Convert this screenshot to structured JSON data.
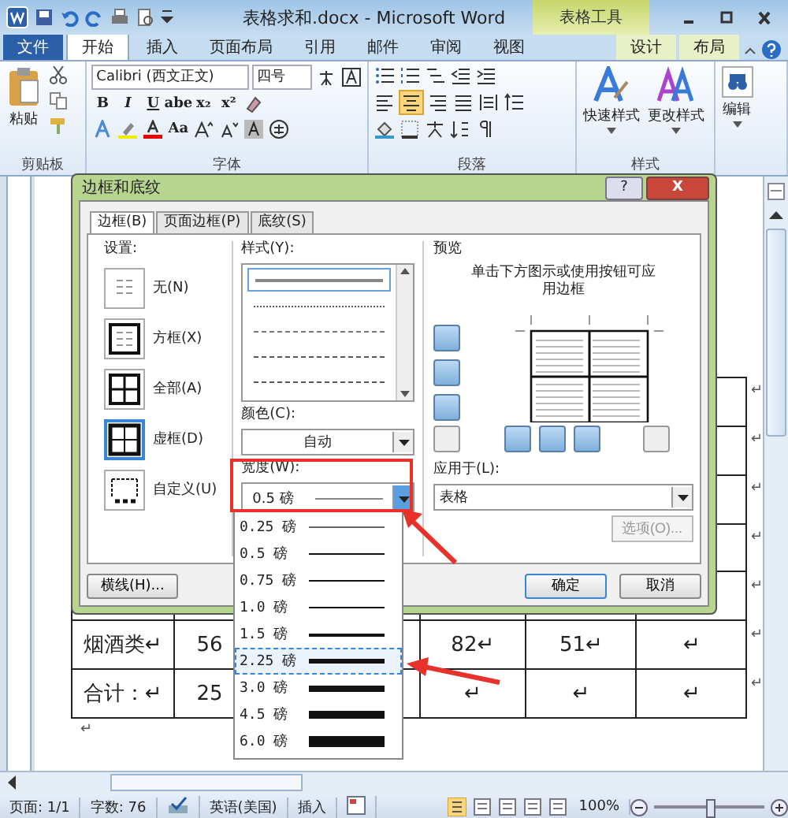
{
  "window": {
    "title": "表格求和.docx  -  Microsoft Word",
    "context_tab": "表格工具"
  },
  "tabs": [
    {
      "label": "文件",
      "kind": "file",
      "selected": false
    },
    {
      "label": "开始",
      "kind": "tab",
      "selected": true
    },
    {
      "label": "插入",
      "kind": "tab",
      "selected": false
    },
    {
      "label": "页面布局",
      "kind": "tab",
      "selected": false
    },
    {
      "label": "引用",
      "kind": "tab",
      "selected": false
    },
    {
      "label": "邮件",
      "kind": "tab",
      "selected": false
    },
    {
      "label": "审阅",
      "kind": "tab",
      "selected": false
    },
    {
      "label": "视图",
      "kind": "tab",
      "selected": false
    },
    {
      "label": "设计",
      "kind": "context",
      "selected": false
    },
    {
      "label": "布局",
      "kind": "context",
      "selected": false
    }
  ],
  "ribbon": {
    "clipboard": {
      "paste": "粘贴",
      "label": "剪贴板"
    },
    "font": {
      "name": "Calibri (西文正文)",
      "size": "四号",
      "format_buttons": [
        "B",
        "I",
        "U",
        "abe",
        "x₂",
        "x²"
      ],
      "case_button": "Aa",
      "label": "字体"
    },
    "paragraph": {
      "label": "段落"
    },
    "styles": {
      "buttons": [
        "快速样式",
        "更改样式"
      ],
      "label": "样式"
    },
    "editing": {
      "button": "编辑"
    }
  },
  "document": {
    "rows": [
      {
        "end": "↵"
      },
      {
        "end": "↵"
      },
      {
        "end": "↵"
      },
      {
        "end": "↵"
      },
      {
        "end": "↵"
      },
      {
        "cells": [
          "烟酒类↵",
          "56",
          "",
          "82↵",
          "51↵",
          "↵"
        ],
        "end": "↵"
      },
      {
        "cells": [
          "合计：↵",
          "25",
          "",
          "↵",
          "↵",
          "↵"
        ],
        "end": "↵"
      }
    ],
    "after_mark": "↵"
  },
  "dialog": {
    "title": "边框和底纹",
    "help": "?",
    "close": "X",
    "tabs": [
      {
        "label": "边框(B)",
        "selected": true
      },
      {
        "label": "页面边框(P)",
        "selected": false
      },
      {
        "label": "底纹(S)",
        "selected": false
      }
    ],
    "setting_label": "设置:",
    "settings": [
      {
        "label": "无(N)",
        "kind": "none",
        "selected": false
      },
      {
        "label": "方框(X)",
        "kind": "box",
        "selected": false
      },
      {
        "label": "全部(A)",
        "kind": "all",
        "selected": false
      },
      {
        "label": "虚框(D)",
        "kind": "grid",
        "selected": true
      },
      {
        "label": "自定义(U)",
        "kind": "custom",
        "selected": false
      }
    ],
    "style_label": "样式(Y):",
    "styles": [
      {
        "kind": "solid",
        "selected": true
      },
      {
        "kind": "dotted",
        "selected": false
      },
      {
        "kind": "fine-dash",
        "selected": false
      },
      {
        "kind": "dashed",
        "selected": false
      },
      {
        "kind": "dash-dot",
        "selected": false
      }
    ],
    "color_label": "颜色(C):",
    "color_value": "自动",
    "width_label": "宽度(W):",
    "width_value": "0.5 磅",
    "preview_label": "预览",
    "preview_hint": "单击下方图示或使用按钮可应用边框",
    "apply_label": "应用于(L):",
    "apply_value": "表格",
    "options": {
      "label": "选项(O)...",
      "disabled": true
    },
    "horizontal_line": "横线(H)...",
    "ok": "确定",
    "cancel": "取消"
  },
  "width_menu": [
    {
      "label": "0.25 磅",
      "kind": "hair",
      "selected": false
    },
    {
      "label": "0.5 磅",
      "kind": "thin",
      "selected": false
    },
    {
      "label": "0.75 磅",
      "kind": "thin",
      "selected": false
    },
    {
      "label": "1.0 磅",
      "kind": "thin",
      "selected": false
    },
    {
      "label": "1.5 磅",
      "kind": "medium",
      "selected": false
    },
    {
      "label": "2.25 磅",
      "kind": "semibold",
      "selected": true
    },
    {
      "label": "3.0 磅",
      "kind": "bold",
      "selected": false
    },
    {
      "label": "4.5 磅",
      "kind": "heavy",
      "selected": false
    },
    {
      "label": "6.0 磅",
      "kind": "black",
      "selected": false
    }
  ],
  "status_bar": {
    "page": "页面: 1/1",
    "words": "字数: 76",
    "language": "英语(美国)",
    "mode": "插入",
    "zoom": "100%",
    "zoom_slider": {
      "level": 0.5
    }
  }
}
